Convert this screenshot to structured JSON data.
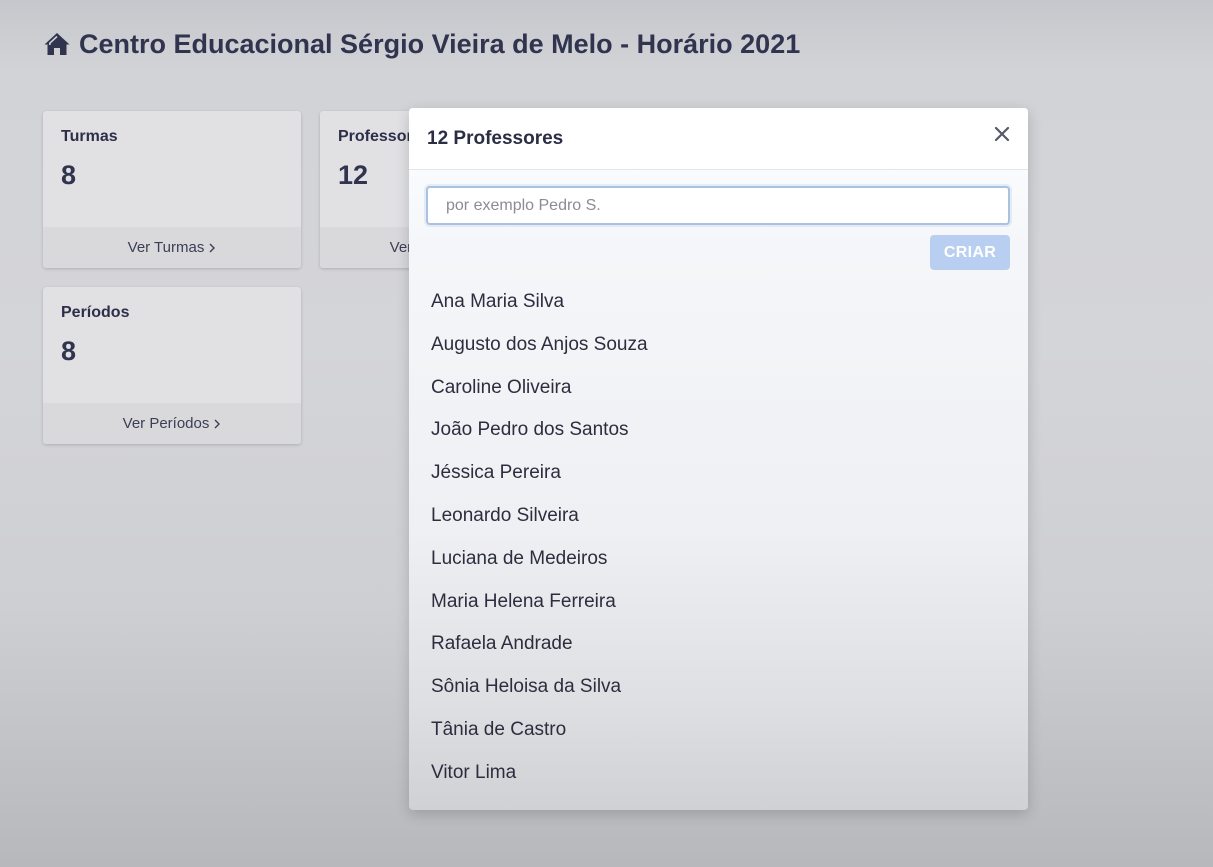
{
  "header": {
    "title": "Centro Educacional Sérgio Vieira de Melo - Horário 2021",
    "icon": "home-icon"
  },
  "cards": {
    "turmas": {
      "title": "Turmas",
      "count": "8",
      "link": "Ver Turmas"
    },
    "professores": {
      "title": "Professores",
      "count": "12",
      "link": "Ver Professores"
    },
    "periodos": {
      "title": "Períodos",
      "count": "8",
      "link": "Ver Períodos"
    }
  },
  "modal": {
    "title": "12 Professores",
    "search_placeholder": "por exemplo Pedro S.",
    "search_value": "",
    "create_label": "CRIAR",
    "teachers": [
      "Ana Maria Silva",
      "Augusto dos Anjos Souza",
      "Caroline Oliveira",
      "João Pedro dos Santos",
      "Jéssica Pereira",
      "Leonardo Silveira",
      "Luciana de Medeiros",
      "Maria Helena Ferreira",
      "Rafaela Andrade",
      "Sônia Heloisa da Silva",
      "Tânia de Castro",
      "Vitor Lima"
    ]
  },
  "colors": {
    "title_text": "#30344f",
    "create_button": "#b9cff1",
    "input_border": "#a9c2e0"
  }
}
